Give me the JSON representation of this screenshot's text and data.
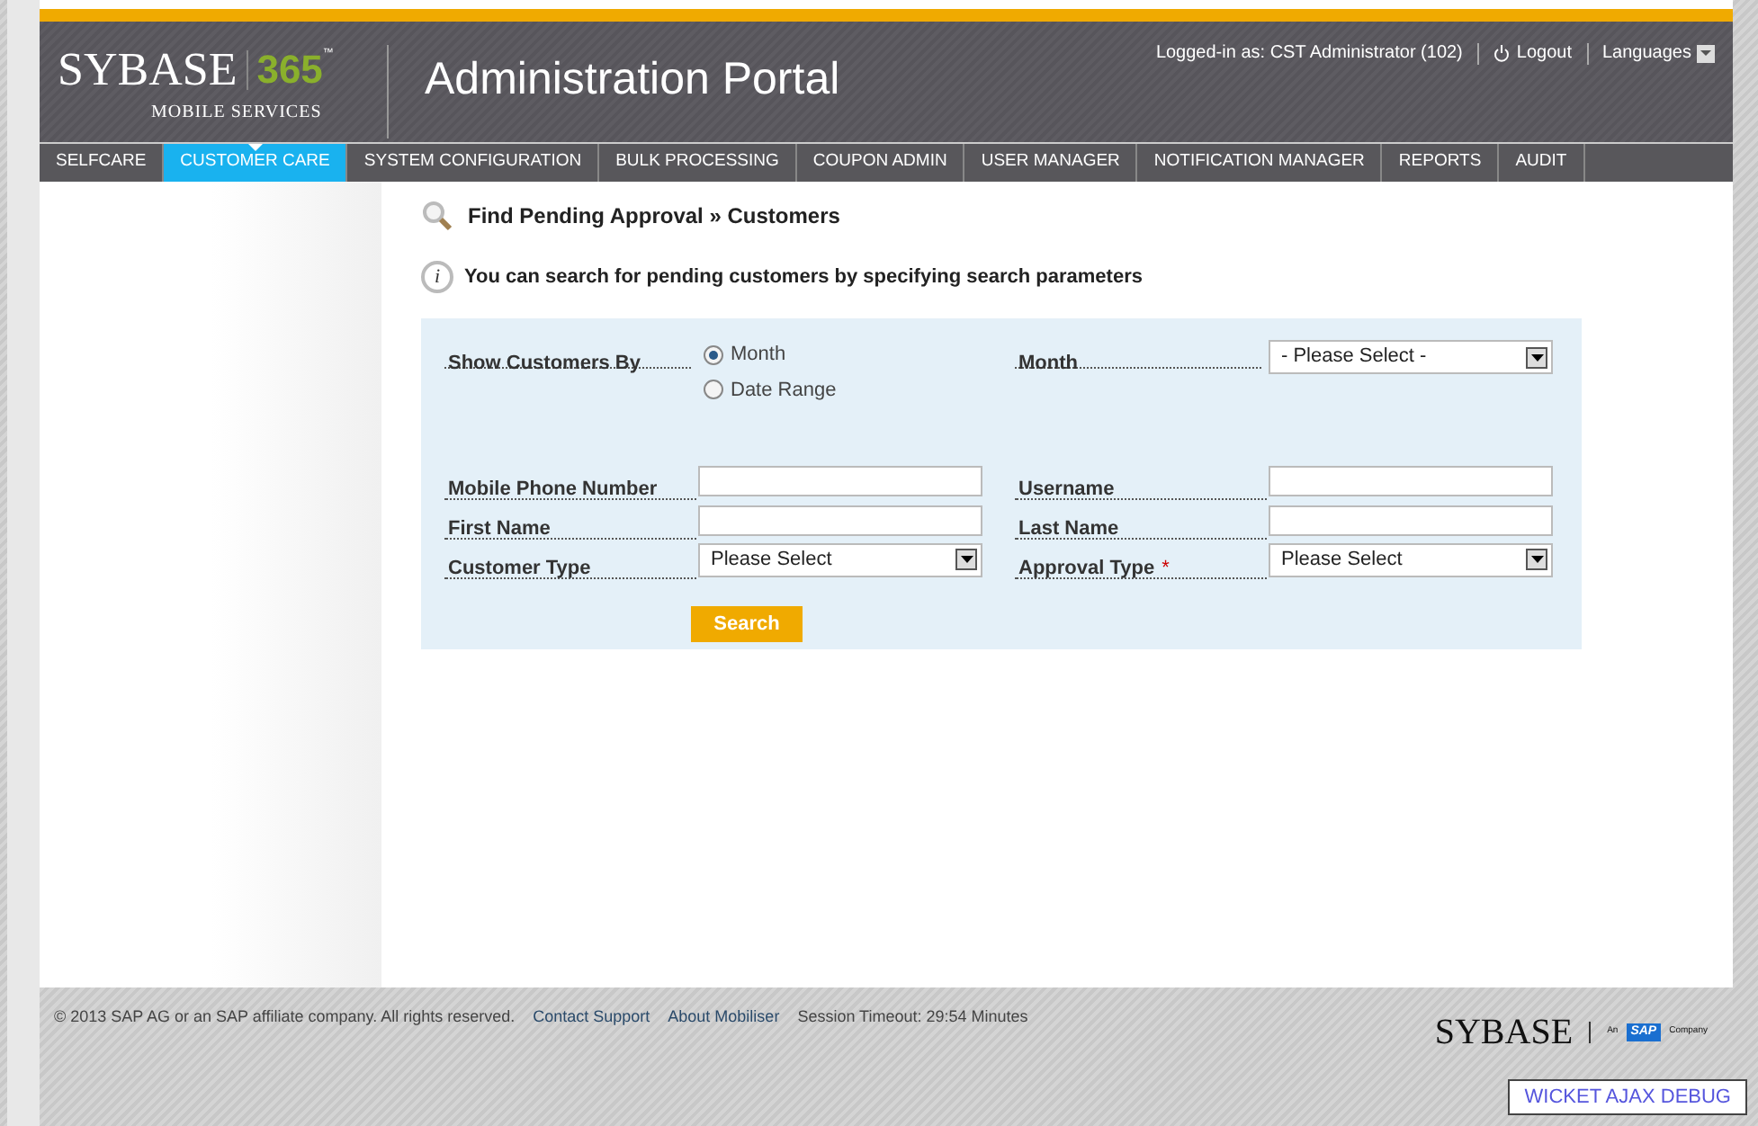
{
  "header": {
    "logo": {
      "brand": "SYBASE",
      "number": "365",
      "tm": "™",
      "subtitle": "MOBILE SERVICES"
    },
    "title": "Administration Portal",
    "user": "Logged-in as: CST Administrator (102)",
    "logout": "Logout",
    "languages": "Languages"
  },
  "tabs": [
    {
      "label": "SELFCARE",
      "selected": false
    },
    {
      "label": "CUSTOMER CARE",
      "selected": true
    },
    {
      "label": "SYSTEM CONFIGURATION",
      "selected": false
    },
    {
      "label": "BULK PROCESSING",
      "selected": false
    },
    {
      "label": "COUPON ADMIN",
      "selected": false
    },
    {
      "label": "USER MANAGER",
      "selected": false
    },
    {
      "label": "NOTIFICATION MANAGER",
      "selected": false
    },
    {
      "label": "REPORTS",
      "selected": false
    },
    {
      "label": "AUDIT",
      "selected": false
    }
  ],
  "page": {
    "breadcrumb": [
      "Find Pending Approval",
      "»",
      "Customers"
    ],
    "info_icon": "i",
    "info": "You can search for pending customers by specifying search parameters"
  },
  "form": {
    "show_by": {
      "label": "Show Customers By",
      "options": [
        {
          "label": "Month",
          "selected": true
        },
        {
          "label": "Date Range",
          "selected": false
        }
      ]
    },
    "month": {
      "label": "Month",
      "value": "- Please Select -"
    },
    "fields": [
      {
        "label": "Mobile Phone Number",
        "kind": "text"
      },
      {
        "label": "Username",
        "kind": "text"
      },
      {
        "label": "First Name",
        "kind": "text"
      },
      {
        "label": "Last Name",
        "kind": "text"
      },
      {
        "label": "Customer Type",
        "kind": "select",
        "value": "Please Select"
      },
      {
        "label": "Approval Type",
        "kind": "select",
        "value": "Please Select",
        "required_mark": "*"
      }
    ],
    "search": "Search"
  },
  "footer": {
    "copyright": "© 2013 SAP AG or an SAP affiliate company. All rights reserved.",
    "links": [
      "Contact Support",
      "About Mobiliser"
    ],
    "session": "Session Timeout: 29:54 Minutes",
    "logo": {
      "brand": "SYBASE",
      "an": "An",
      "sap": "SAP",
      "company": "Company"
    },
    "debug": "WICKET AJAX DEBUG"
  }
}
